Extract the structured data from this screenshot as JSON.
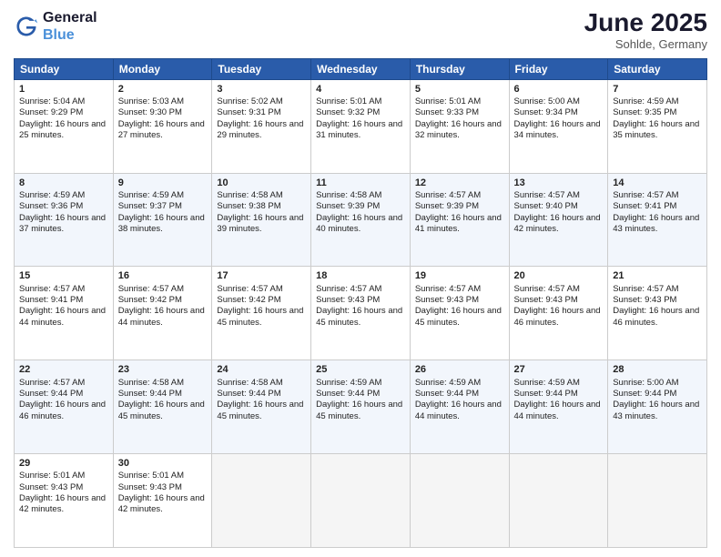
{
  "header": {
    "logo_line1": "General",
    "logo_line2": "Blue",
    "month": "June 2025",
    "location": "Sohlde, Germany"
  },
  "weekdays": [
    "Sunday",
    "Monday",
    "Tuesday",
    "Wednesday",
    "Thursday",
    "Friday",
    "Saturday"
  ],
  "weeks": [
    [
      {
        "day": "1",
        "sunrise": "Sunrise: 5:04 AM",
        "sunset": "Sunset: 9:29 PM",
        "daylight": "Daylight: 16 hours and 25 minutes."
      },
      {
        "day": "2",
        "sunrise": "Sunrise: 5:03 AM",
        "sunset": "Sunset: 9:30 PM",
        "daylight": "Daylight: 16 hours and 27 minutes."
      },
      {
        "day": "3",
        "sunrise": "Sunrise: 5:02 AM",
        "sunset": "Sunset: 9:31 PM",
        "daylight": "Daylight: 16 hours and 29 minutes."
      },
      {
        "day": "4",
        "sunrise": "Sunrise: 5:01 AM",
        "sunset": "Sunset: 9:32 PM",
        "daylight": "Daylight: 16 hours and 31 minutes."
      },
      {
        "day": "5",
        "sunrise": "Sunrise: 5:01 AM",
        "sunset": "Sunset: 9:33 PM",
        "daylight": "Daylight: 16 hours and 32 minutes."
      },
      {
        "day": "6",
        "sunrise": "Sunrise: 5:00 AM",
        "sunset": "Sunset: 9:34 PM",
        "daylight": "Daylight: 16 hours and 34 minutes."
      },
      {
        "day": "7",
        "sunrise": "Sunrise: 4:59 AM",
        "sunset": "Sunset: 9:35 PM",
        "daylight": "Daylight: 16 hours and 35 minutes."
      }
    ],
    [
      {
        "day": "8",
        "sunrise": "Sunrise: 4:59 AM",
        "sunset": "Sunset: 9:36 PM",
        "daylight": "Daylight: 16 hours and 37 minutes."
      },
      {
        "day": "9",
        "sunrise": "Sunrise: 4:59 AM",
        "sunset": "Sunset: 9:37 PM",
        "daylight": "Daylight: 16 hours and 38 minutes."
      },
      {
        "day": "10",
        "sunrise": "Sunrise: 4:58 AM",
        "sunset": "Sunset: 9:38 PM",
        "daylight": "Daylight: 16 hours and 39 minutes."
      },
      {
        "day": "11",
        "sunrise": "Sunrise: 4:58 AM",
        "sunset": "Sunset: 9:39 PM",
        "daylight": "Daylight: 16 hours and 40 minutes."
      },
      {
        "day": "12",
        "sunrise": "Sunrise: 4:57 AM",
        "sunset": "Sunset: 9:39 PM",
        "daylight": "Daylight: 16 hours and 41 minutes."
      },
      {
        "day": "13",
        "sunrise": "Sunrise: 4:57 AM",
        "sunset": "Sunset: 9:40 PM",
        "daylight": "Daylight: 16 hours and 42 minutes."
      },
      {
        "day": "14",
        "sunrise": "Sunrise: 4:57 AM",
        "sunset": "Sunset: 9:41 PM",
        "daylight": "Daylight: 16 hours and 43 minutes."
      }
    ],
    [
      {
        "day": "15",
        "sunrise": "Sunrise: 4:57 AM",
        "sunset": "Sunset: 9:41 PM",
        "daylight": "Daylight: 16 hours and 44 minutes."
      },
      {
        "day": "16",
        "sunrise": "Sunrise: 4:57 AM",
        "sunset": "Sunset: 9:42 PM",
        "daylight": "Daylight: 16 hours and 44 minutes."
      },
      {
        "day": "17",
        "sunrise": "Sunrise: 4:57 AM",
        "sunset": "Sunset: 9:42 PM",
        "daylight": "Daylight: 16 hours and 45 minutes."
      },
      {
        "day": "18",
        "sunrise": "Sunrise: 4:57 AM",
        "sunset": "Sunset: 9:43 PM",
        "daylight": "Daylight: 16 hours and 45 minutes."
      },
      {
        "day": "19",
        "sunrise": "Sunrise: 4:57 AM",
        "sunset": "Sunset: 9:43 PM",
        "daylight": "Daylight: 16 hours and 45 minutes."
      },
      {
        "day": "20",
        "sunrise": "Sunrise: 4:57 AM",
        "sunset": "Sunset: 9:43 PM",
        "daylight": "Daylight: 16 hours and 46 minutes."
      },
      {
        "day": "21",
        "sunrise": "Sunrise: 4:57 AM",
        "sunset": "Sunset: 9:43 PM",
        "daylight": "Daylight: 16 hours and 46 minutes."
      }
    ],
    [
      {
        "day": "22",
        "sunrise": "Sunrise: 4:57 AM",
        "sunset": "Sunset: 9:44 PM",
        "daylight": "Daylight: 16 hours and 46 minutes."
      },
      {
        "day": "23",
        "sunrise": "Sunrise: 4:58 AM",
        "sunset": "Sunset: 9:44 PM",
        "daylight": "Daylight: 16 hours and 45 minutes."
      },
      {
        "day": "24",
        "sunrise": "Sunrise: 4:58 AM",
        "sunset": "Sunset: 9:44 PM",
        "daylight": "Daylight: 16 hours and 45 minutes."
      },
      {
        "day": "25",
        "sunrise": "Sunrise: 4:59 AM",
        "sunset": "Sunset: 9:44 PM",
        "daylight": "Daylight: 16 hours and 45 minutes."
      },
      {
        "day": "26",
        "sunrise": "Sunrise: 4:59 AM",
        "sunset": "Sunset: 9:44 PM",
        "daylight": "Daylight: 16 hours and 44 minutes."
      },
      {
        "day": "27",
        "sunrise": "Sunrise: 4:59 AM",
        "sunset": "Sunset: 9:44 PM",
        "daylight": "Daylight: 16 hours and 44 minutes."
      },
      {
        "day": "28",
        "sunrise": "Sunrise: 5:00 AM",
        "sunset": "Sunset: 9:44 PM",
        "daylight": "Daylight: 16 hours and 43 minutes."
      }
    ],
    [
      {
        "day": "29",
        "sunrise": "Sunrise: 5:01 AM",
        "sunset": "Sunset: 9:43 PM",
        "daylight": "Daylight: 16 hours and 42 minutes."
      },
      {
        "day": "30",
        "sunrise": "Sunrise: 5:01 AM",
        "sunset": "Sunset: 9:43 PM",
        "daylight": "Daylight: 16 hours and 42 minutes."
      },
      null,
      null,
      null,
      null,
      null
    ]
  ]
}
